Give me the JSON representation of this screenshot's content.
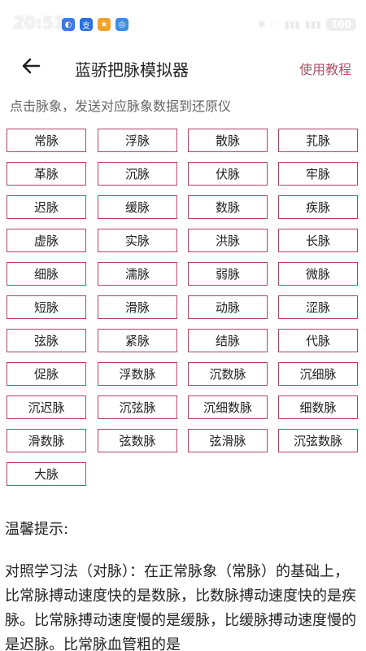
{
  "status_bar": {
    "time": "20:51",
    "battery": "100"
  },
  "header": {
    "title": "蓝骄把脉模拟器",
    "help_label": "使用教程"
  },
  "subtitle": "点击脉象，发送对应脉象数据到还原仪",
  "pulses": [
    "常脉",
    "浮脉",
    "散脉",
    "芤脉",
    "革脉",
    "沉脉",
    "伏脉",
    "牢脉",
    "迟脉",
    "缓脉",
    "数脉",
    "疾脉",
    "虚脉",
    "实脉",
    "洪脉",
    "长脉",
    "细脉",
    "濡脉",
    "弱脉",
    "微脉",
    "短脉",
    "滑脉",
    "动脉",
    "涩脉",
    "弦脉",
    "紧脉",
    "结脉",
    "代脉",
    "促脉",
    "浮数脉",
    "沉数脉",
    "沉细脉",
    "沉迟脉",
    "沉弦脉",
    "沉细数脉",
    "细数脉",
    "滑数脉",
    "弦数脉",
    "弦滑脉",
    "沉弦数脉",
    "大脉"
  ],
  "tips": {
    "title": "温馨提示:",
    "body": "对照学习法（对脉）：在正常脉象（常脉）的基础上，比常脉搏动速度快的是数脉，比数脉搏动速度快的是疾脉。比常脉搏动速度慢的是缓脉，比缓脉搏动速度慢的是迟脉。比常脉血管粗的是"
  },
  "colors": {
    "accent": "#b24562",
    "help": "#b05068"
  }
}
